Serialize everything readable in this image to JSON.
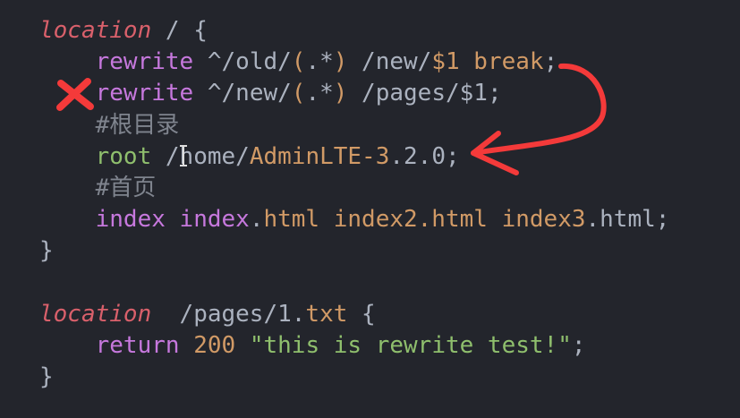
{
  "colors": {
    "background": "#23252c",
    "annotation": "#f43a3a"
  },
  "code_lines": [
    [
      {
        "text": "location",
        "cls": "kw-loc"
      },
      {
        "text": " / {",
        "cls": "gray"
      }
    ],
    [
      {
        "text": "    ",
        "cls": "gray"
      },
      {
        "text": "rewrite",
        "cls": "purple"
      },
      {
        "text": " ^/old/",
        "cls": "gray"
      },
      {
        "text": "(",
        "cls": "orange"
      },
      {
        "text": ".*",
        "cls": "gray"
      },
      {
        "text": ")",
        "cls": "orange"
      },
      {
        "text": " /new/",
        "cls": "gray"
      },
      {
        "text": "$1 break",
        "cls": "orange"
      },
      {
        "text": ";",
        "cls": "gray"
      }
    ],
    [
      {
        "text": "    ",
        "cls": "gray"
      },
      {
        "text": "rewrite",
        "cls": "purple"
      },
      {
        "text": " ^/new/",
        "cls": "gray"
      },
      {
        "text": "(",
        "cls": "orange"
      },
      {
        "text": ".*",
        "cls": "gray"
      },
      {
        "text": ")",
        "cls": "orange"
      },
      {
        "text": " /pages/$1;",
        "cls": "gray"
      }
    ],
    [
      {
        "text": "    ",
        "cls": "gray"
      },
      {
        "text": "#根目录",
        "cls": "comment"
      }
    ],
    [
      {
        "text": "    ",
        "cls": "gray"
      },
      {
        "text": "root",
        "cls": "green"
      },
      {
        "text": " /home/",
        "cls": "gray"
      },
      {
        "text": "AdminLTE-3",
        "cls": "orange"
      },
      {
        "text": ".2.0;",
        "cls": "gray"
      }
    ],
    [
      {
        "text": "    ",
        "cls": "gray"
      },
      {
        "text": "#首页",
        "cls": "comment"
      }
    ],
    [
      {
        "text": "    ",
        "cls": "gray"
      },
      {
        "text": "index index",
        "cls": "purple"
      },
      {
        "text": ".",
        "cls": "gray"
      },
      {
        "text": "html index2.html index3",
        "cls": "orange"
      },
      {
        "text": ".html;",
        "cls": "gray"
      }
    ],
    [
      {
        "text": "}",
        "cls": "gray"
      }
    ],
    [
      {
        "text": "",
        "cls": "gray"
      }
    ],
    [
      {
        "text": "location",
        "cls": "kw-loc"
      },
      {
        "text": "  /pages/1.",
        "cls": "gray"
      },
      {
        "text": "txt",
        "cls": "orange"
      },
      {
        "text": " {",
        "cls": "gray"
      }
    ],
    [
      {
        "text": "    ",
        "cls": "gray"
      },
      {
        "text": "return",
        "cls": "purple"
      },
      {
        "text": " 200",
        "cls": "orange"
      },
      {
        "text": " \"this is rewrite test!\"",
        "cls": "green"
      },
      {
        "text": ";",
        "cls": "gray"
      }
    ],
    [
      {
        "text": "}",
        "cls": "gray"
      }
    ]
  ]
}
